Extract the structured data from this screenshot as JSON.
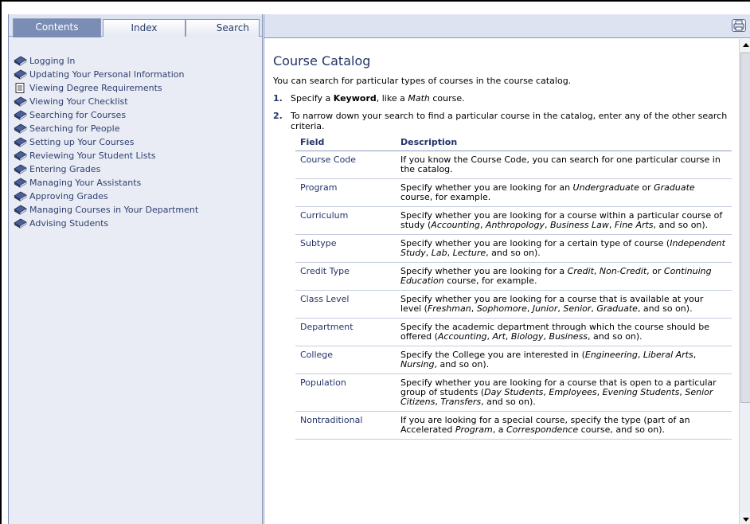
{
  "tabs": [
    {
      "label": "Contents",
      "active": true
    },
    {
      "label": "Index",
      "active": false
    },
    {
      "label": "Search",
      "active": false
    }
  ],
  "toc": [
    {
      "label": "Logging In",
      "icon": "book-icon"
    },
    {
      "label": "Updating Your Personal Information",
      "icon": "book-icon"
    },
    {
      "label": "Viewing Degree Requirements",
      "icon": "page-icon"
    },
    {
      "label": "Viewing Your Checklist",
      "icon": "book-icon"
    },
    {
      "label": "Searching for Courses",
      "icon": "book-icon"
    },
    {
      "label": "Searching for People",
      "icon": "book-icon"
    },
    {
      "label": "Setting up Your Courses",
      "icon": "book-icon"
    },
    {
      "label": "Reviewing Your Student Lists",
      "icon": "book-icon"
    },
    {
      "label": "Entering Grades",
      "icon": "book-icon"
    },
    {
      "label": "Managing Your Assistants",
      "icon": "book-icon"
    },
    {
      "label": "Approving Grades",
      "icon": "book-icon"
    },
    {
      "label": "Managing Courses in Your Department",
      "icon": "book-icon"
    },
    {
      "label": "Advising Students",
      "icon": "book-icon"
    }
  ],
  "toolbar": {
    "print_icon": "print-icon"
  },
  "content": {
    "title": "Course Catalog",
    "intro": "You can search for particular types of courses in the course catalog.",
    "step1": {
      "num": "1.",
      "pre": "Specify a ",
      "keyword": "Keyword",
      "mid": ", like a ",
      "example": "Math",
      "post": " course."
    },
    "step2": {
      "num": "2.",
      "text": "To narrow down your search to find a particular course in the catalog, enter any of the other search criteria."
    },
    "table": {
      "headers": [
        "Field",
        "Description"
      ],
      "rows": [
        {
          "field": "Course Code",
          "desc": "If you know the Course Code, you can search for one particular course in the catalog."
        },
        {
          "field": "Program",
          "desc": "Specify whether you are looking for an <i>Undergraduate</i> or <i>Graduate</i> course, for example."
        },
        {
          "field": "Curriculum",
          "desc": "Specify whether you are looking for a course within a particular course of study (<i>Accounting</i>, <i>Anthropology</i>, <i>Business Law</i>, <i>Fine Arts</i>, and so on)."
        },
        {
          "field": "Subtype",
          "desc": "Specify whether you are looking for a certain type of course (<i>Independent Study</i>, <i>Lab</i>, <i>Lecture</i>, and so on)."
        },
        {
          "field": "Credit Type",
          "desc": "Specify whether you are looking for a <i>Credit</i>, <i>Non-Credit</i>, or <i>Continuing Education</i> course, for example."
        },
        {
          "field": "Class Level",
          "desc": "Specify whether you are looking for a course that is available at your level (<i>Freshman</i>, <i>Sophomore</i>, <i>Junior</i>, <i>Senior</i>, <i>Graduate</i>, and so on)."
        },
        {
          "field": "Department",
          "desc": "Specify the academic department through which the course should be offered (<i>Accounting</i>, <i>Art</i>, <i>Biology</i>, <i>Business</i>, and so on)."
        },
        {
          "field": "College",
          "desc": "Specify the College you are interested in (<i>Engineering</i>, <i>Liberal Arts</i>, <i>Nursing</i>, and so on)."
        },
        {
          "field": "Population",
          "desc": "Specify whether you are looking for a course that is open to a particular group of students (<i>Day Students</i>, <i>Employees</i>, <i>Evening Students</i>, <i>Senior Citizens</i>, <i>Transfers</i>, and so on)."
        },
        {
          "field": "Nontraditional",
          "desc": "If you are looking for a special course, specify the type (part of an Accelerated <i>Program</i>, a <i>Correspondence</i> course, and so on)."
        }
      ]
    }
  },
  "colors": {
    "accent": "#22336a",
    "pane": "#e9ecf4",
    "tab_active": "#7b8db5"
  }
}
